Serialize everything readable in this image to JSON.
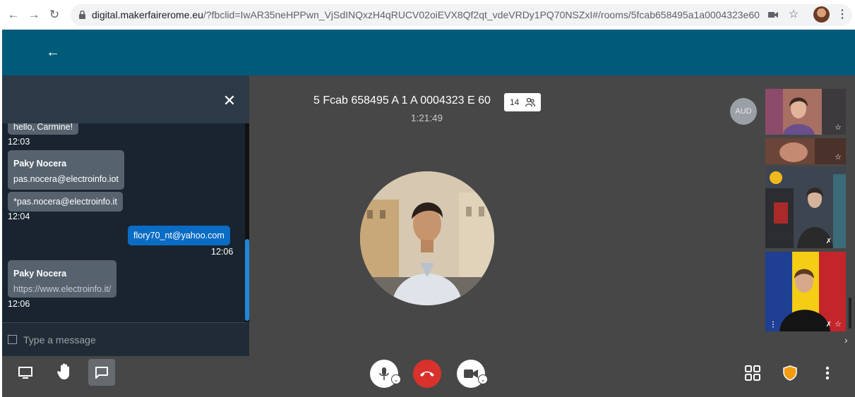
{
  "browser": {
    "url_host": "digital.makerfairerome.eu",
    "url_rest": "/?fbclid=IwAR35neHPPwn_VjSdINQxzH4qRUCV02oiEVX8Qf2qt_vdeVRDy1PQ70NSZxI#/rooms/5fcab658495a1a0004323e60"
  },
  "room": {
    "title": "5 Fcab 658495 A 1 A 0004323 E 60",
    "elapsed": "1:21:49",
    "participant_count": "14",
    "aud_label": "AUD"
  },
  "chat": {
    "messages": [
      {
        "text": "hello, Carmine!",
        "time": "12:03"
      },
      {
        "sender": "Paky Nocera",
        "lines": [
          "pas.nocera@electroinfo.iot",
          "*pas.nocera@electroinfo.it"
        ],
        "time": "12:04"
      },
      {
        "own": true,
        "text": "flory70_nt@yahoo.com",
        "time": "12:06"
      },
      {
        "sender": "Paky Nocera",
        "link": "https://www.electroinfo.it/",
        "time": "12:06"
      }
    ],
    "input_placeholder": "Type a message"
  },
  "colors": {
    "topbar": "#005a7a",
    "stage": "#474747",
    "chat_bg": "#202b36",
    "hangup": "#d9312b",
    "own_bubble": "#0a6cc4",
    "shield": "#f39c12"
  },
  "icons": {
    "toolbar_left": [
      "screen-share-icon",
      "raise-hand-icon",
      "chat-icon"
    ],
    "toolbar_center": [
      "microphone-icon",
      "hangup-icon",
      "camera-icon"
    ],
    "toolbar_right": [
      "grid-view-icon",
      "shield-icon",
      "more-vertical-icon"
    ]
  }
}
